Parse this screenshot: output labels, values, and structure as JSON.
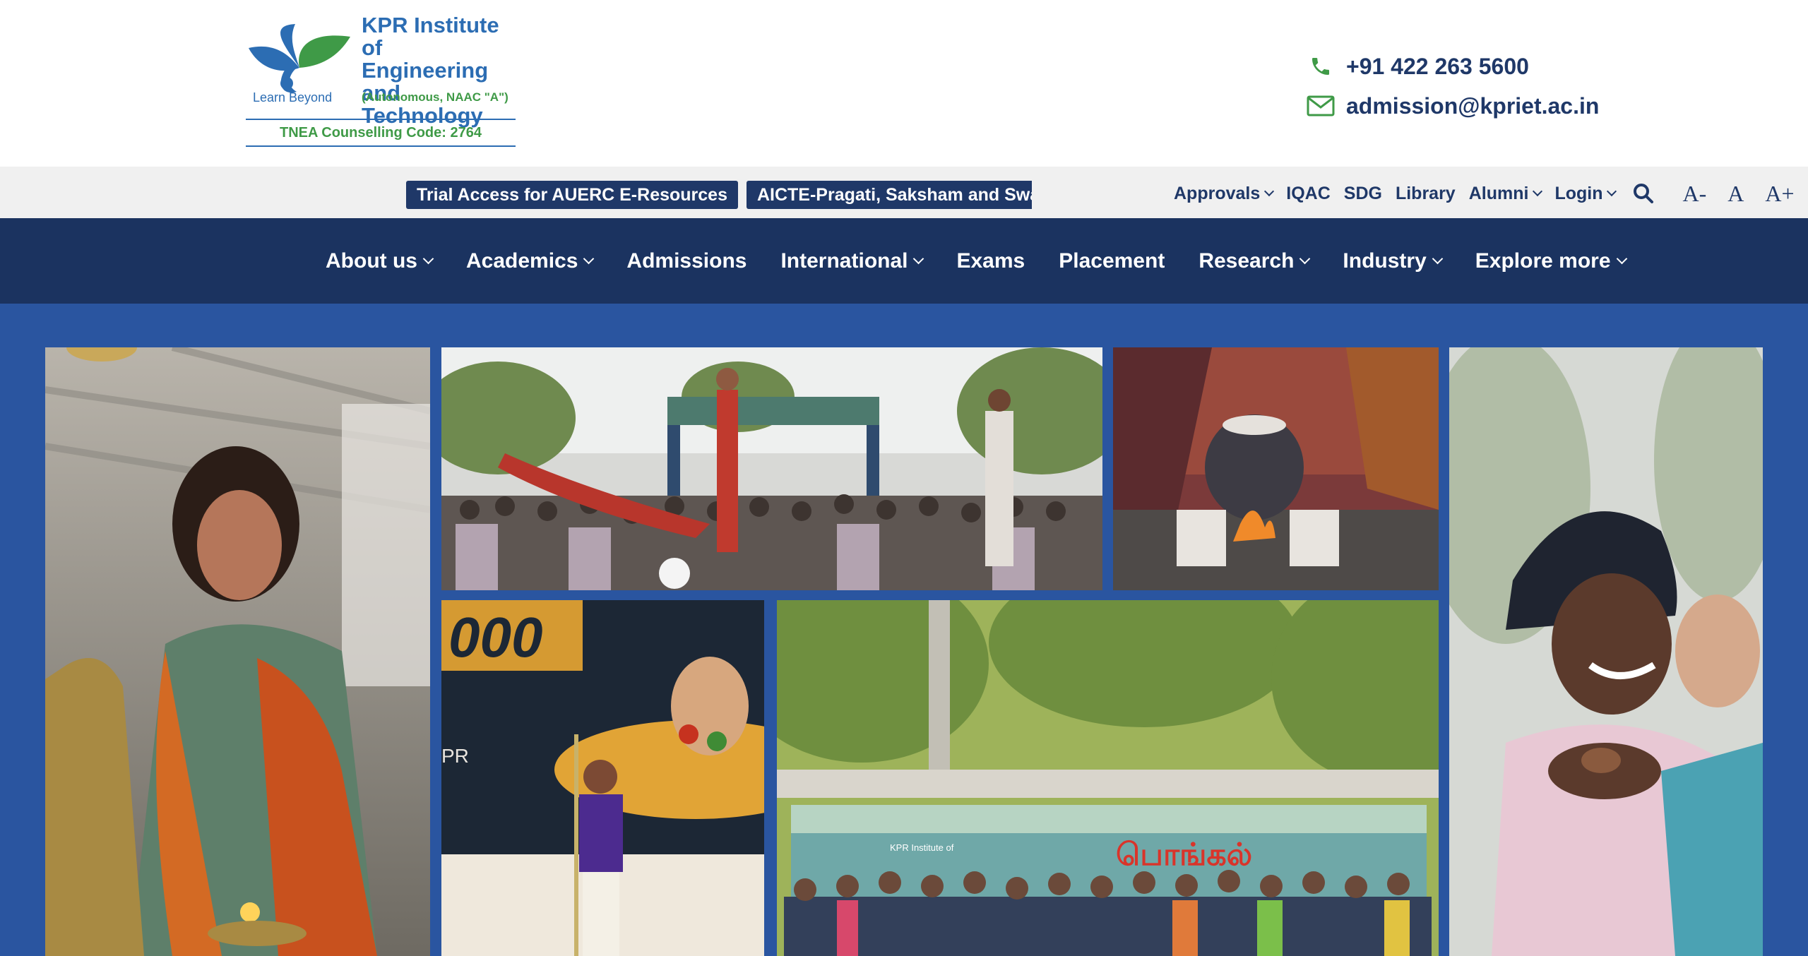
{
  "header": {
    "logo": {
      "title_lines": [
        "KPR Institute of",
        "Engineering and",
        "Technology"
      ],
      "tagline": "Learn Beyond",
      "accreditation": "(Autonomous, NAAC \"A\")",
      "counselling_code": "TNEA Counselling Code: 2764"
    },
    "contact": {
      "phone": "+91 422 263 5600",
      "email": "admission@kpriet.ac.in",
      "phone_icon": "phone-icon",
      "email_icon": "envelope-icon"
    }
  },
  "utility_bar": {
    "announcements": [
      "Trial Access for AUERC E-Resources",
      "AICTE-Pragati, Saksham and Swanath Scholarship"
    ],
    "links": [
      {
        "label": "Approvals",
        "has_dropdown": true
      },
      {
        "label": "IQAC",
        "has_dropdown": false
      },
      {
        "label": "SDG",
        "has_dropdown": false
      },
      {
        "label": "Library",
        "has_dropdown": false
      },
      {
        "label": "Alumni",
        "has_dropdown": true
      },
      {
        "label": "Login",
        "has_dropdown": true
      }
    ],
    "search_icon": "search-icon",
    "font_controls": [
      "A-",
      "A",
      "A+"
    ]
  },
  "main_nav": {
    "items": [
      {
        "label": "About us",
        "has_dropdown": true
      },
      {
        "label": "Academics",
        "has_dropdown": true
      },
      {
        "label": "Admissions",
        "has_dropdown": false
      },
      {
        "label": "International",
        "has_dropdown": true
      },
      {
        "label": "Exams",
        "has_dropdown": false
      },
      {
        "label": "Placement",
        "has_dropdown": false
      },
      {
        "label": "Research",
        "has_dropdown": true
      },
      {
        "label": "Industry",
        "has_dropdown": true
      },
      {
        "label": "Explore more",
        "has_dropdown": true
      }
    ]
  },
  "hero": {
    "photos": [
      "lamp-lighting-photo",
      "folk-dance-procession-photo",
      "pongal-pot-photo",
      "child-with-stick-photo",
      "group-photo-pongal-banner",
      "student-smiling-photo"
    ],
    "banner_text": "பொங்கல்"
  },
  "colors": {
    "navy": "#1b3360",
    "brand_blue": "#2c6db3",
    "brand_green": "#3f9a47",
    "hero_bg": "#2a55a0",
    "utility_bg": "#f0f0f0"
  }
}
